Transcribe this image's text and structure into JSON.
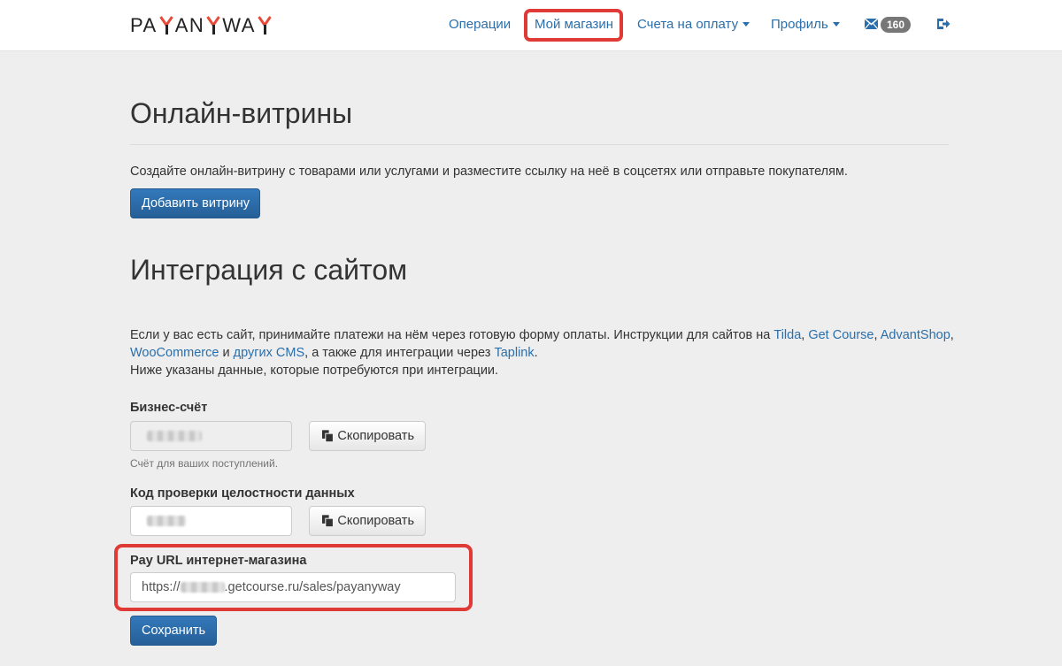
{
  "brand": {
    "logo_pre": "PA",
    "logo_mid": "AN",
    "logo_post": "WA",
    "accent_color": "#e84a3a"
  },
  "nav": {
    "operations": "Операции",
    "my_shop": "Мой магазин",
    "invoices": "Счета на оплату",
    "profile": "Профиль",
    "messages_count": "160",
    "link_color": "#2a6fab"
  },
  "showcases": {
    "title": "Онлайн-витрины",
    "description": "Создайте онлайн-витрину с товарами или услугами и разместите ссылку на неё в соцсетях или отправьте покупателям.",
    "add_button": "Добавить витрину"
  },
  "integration": {
    "title": "Интеграция с сайтом",
    "intro_1": "Если у вас есть сайт, принимайте платежи на нём через готовую форму оплаты. Инструкции для сайтов на ",
    "link_tilda": "Tilda",
    "sep_1": ", ",
    "link_getcourse": "Get Course",
    "sep_2": ", ",
    "link_advantshop": "AdvantShop",
    "sep_3": ",",
    "link_woocommerce": "WooCommerce",
    "and_word": " и ",
    "link_other_cms": "других CMS",
    "taplink_text": ", а также для интеграции через ",
    "link_taplink": "Taplink",
    "period": ".",
    "intro_2": "Ниже указаны данные, которые потребуются при интеграции."
  },
  "form": {
    "account_label": "Бизнес-счёт",
    "account_help": "Счёт для ваших поступлений.",
    "integrity_label": "Код проверки целостности данных",
    "pay_url_label": "Pay URL интернет-магазина",
    "pay_url_prefix": "https://",
    "pay_url_suffix": ".getcourse.ru/sales/payanyway",
    "copy_button": "Скопировать",
    "save_button": "Сохранить"
  },
  "icons": {
    "mail": "envelope-icon",
    "logout": "logout-icon",
    "copy": "copy-icon",
    "caret": "caret-down-icon"
  },
  "colors": {
    "primary": "#337ab7",
    "highlight": "#e03a36"
  }
}
